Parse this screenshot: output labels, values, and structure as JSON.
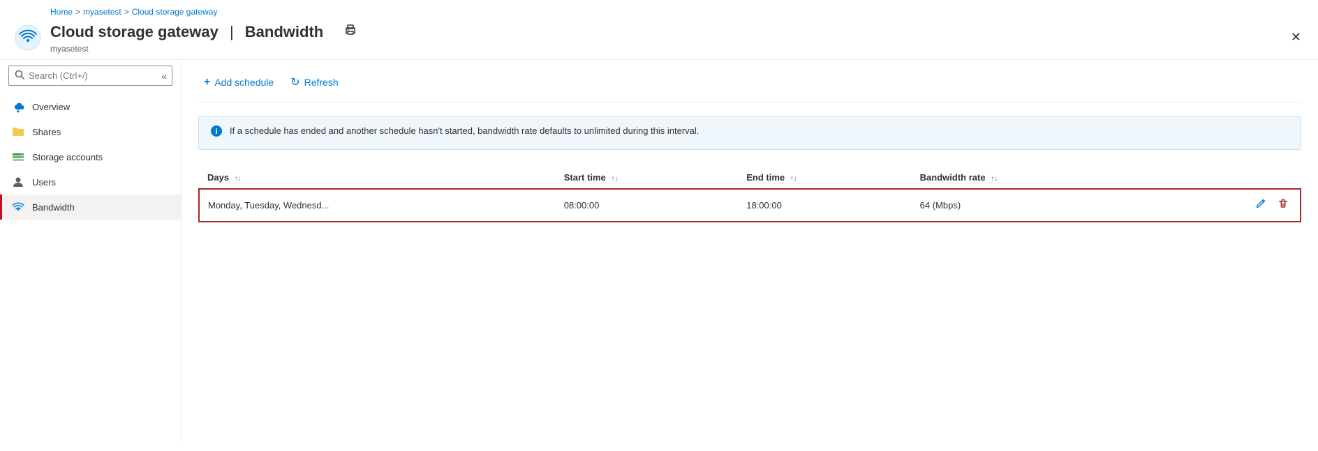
{
  "breadcrumb": {
    "home": "Home",
    "separator1": ">",
    "resource": "myasetest",
    "separator2": ">",
    "page": "Cloud storage gateway"
  },
  "header": {
    "title": "Cloud storage gateway",
    "separator": "|",
    "subtitle_page": "Bandwidth",
    "resource_name": "myasetest"
  },
  "sidebar": {
    "search_placeholder": "Search (Ctrl+/)",
    "collapse_icon": "«",
    "nav_items": [
      {
        "id": "overview",
        "label": "Overview",
        "icon": "cloud"
      },
      {
        "id": "shares",
        "label": "Shares",
        "icon": "folder"
      },
      {
        "id": "storage-accounts",
        "label": "Storage accounts",
        "icon": "storage"
      },
      {
        "id": "users",
        "label": "Users",
        "icon": "person"
      },
      {
        "id": "bandwidth",
        "label": "Bandwidth",
        "icon": "wifi",
        "active": true
      }
    ]
  },
  "toolbar": {
    "add_schedule_label": "Add schedule",
    "refresh_label": "Refresh",
    "add_icon": "+",
    "refresh_icon": "↻"
  },
  "info_banner": {
    "text": "If a schedule has ended and another schedule hasn't started, bandwidth rate defaults to unlimited during this interval."
  },
  "table": {
    "columns": [
      {
        "key": "days",
        "label": "Days"
      },
      {
        "key": "start_time",
        "label": "Start time"
      },
      {
        "key": "end_time",
        "label": "End time"
      },
      {
        "key": "bandwidth_rate",
        "label": "Bandwidth rate"
      }
    ],
    "rows": [
      {
        "days": "Monday, Tuesday, Wednesd...",
        "start_time": "08:00:00",
        "end_time": "18:00:00",
        "bandwidth_rate": "64 (Mbps)"
      }
    ]
  },
  "actions": {
    "edit_icon": "✏",
    "delete_icon": "🗑"
  }
}
